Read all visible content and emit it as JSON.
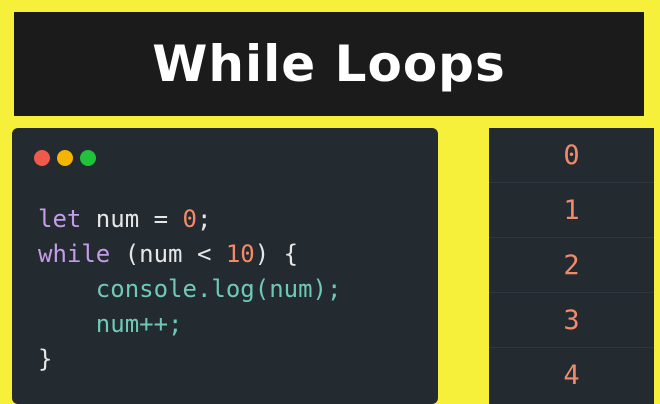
{
  "title": "While Loops",
  "window_controls": {
    "close_color": "#f05a4a",
    "minimize_color": "#f4b400",
    "maximize_color": "#1fc23a"
  },
  "code": {
    "line1": {
      "kw": "let",
      "text": " num = ",
      "num": "0",
      "end": ";"
    },
    "line2": {
      "kw": "while",
      "open": " (num < ",
      "num": "10",
      "close": ") {"
    },
    "line3": {
      "indent": "    ",
      "fn": "console.log(num);"
    },
    "line4": {
      "indent": "    ",
      "fn": "num++;"
    },
    "line5": {
      "text": "}"
    }
  },
  "output": [
    "0",
    "1",
    "2",
    "3",
    "4"
  ],
  "colors": {
    "background": "#f7f03a",
    "title_bar": "#1b1b1b",
    "editor_bg": "#232a30",
    "keyword": "#c39de8",
    "number": "#f28a6a",
    "function": "#6ec9b8"
  }
}
